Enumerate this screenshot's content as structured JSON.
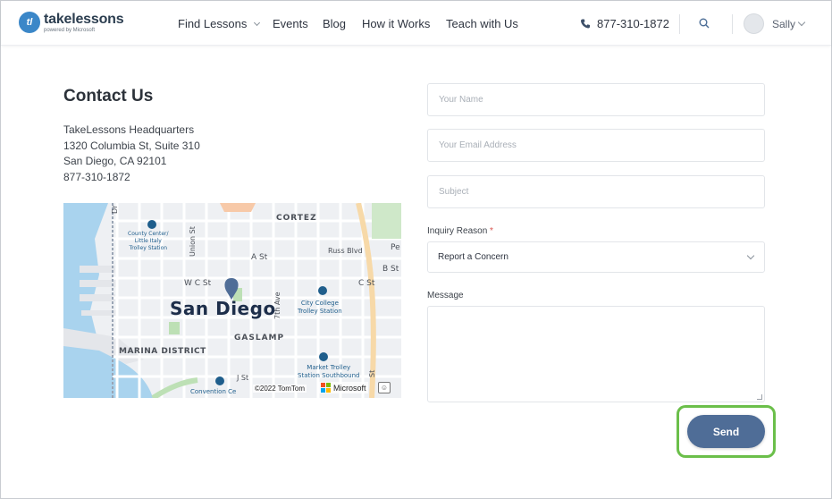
{
  "header": {
    "logo": {
      "name": "takelessons",
      "sub": "powered by Microsoft",
      "mark": "tl"
    },
    "nav": [
      {
        "label": "Find Lessons",
        "has_dropdown": true
      },
      {
        "label": "Events"
      },
      {
        "label": "Blog"
      },
      {
        "label": "How it Works"
      },
      {
        "label": "Teach with Us"
      }
    ],
    "phone": "877-310-1872",
    "user": {
      "name": "Sally"
    }
  },
  "contact": {
    "title": "Contact Us",
    "address_lines": [
      "TakeLessons Headquarters",
      "1320 Columbia St, Suite 310",
      "San Diego, CA 92101",
      "877-310-1872"
    ]
  },
  "map": {
    "labels": {
      "cortez": "CORTEZ",
      "county_center": "County Center/",
      "little_italy": "Little Italy",
      "trolley_station": "Trolley Station",
      "union_st": "Union St",
      "a_st": "A St",
      "russ_blvd": "Russ Blvd",
      "b_st": "B St",
      "w_c_st": "W C St",
      "c_st": "C St",
      "city_college": "City College",
      "city_college_trolley": "Trolley Station",
      "city": "San Diego",
      "seventh_ave": "7th Ave",
      "gaslamp": "GASLAMP",
      "marina": "MARINA DISTRICT",
      "market_trolley": "Market Trolley",
      "station_southbound": "Station Southbound",
      "j_st": "J St",
      "convention": "Convention Ce",
      "dr": "Dr",
      "pe": "Pe",
      "st_vertical": "St"
    },
    "attribution": "©2022 TomTom",
    "ms_label": "Microsoft",
    "feedback_glyph": "☺"
  },
  "form": {
    "name_placeholder": "Your Name",
    "email_placeholder": "Your Email Address",
    "subject_placeholder": "Subject",
    "inquiry_label": "Inquiry Reason",
    "required_mark": "*",
    "inquiry_value": "Report a Concern",
    "message_label": "Message",
    "send_label": "Send"
  },
  "colors": {
    "accent": "#4f6d97",
    "highlight": "#6bbf4a",
    "logo": "#3b87c8"
  }
}
